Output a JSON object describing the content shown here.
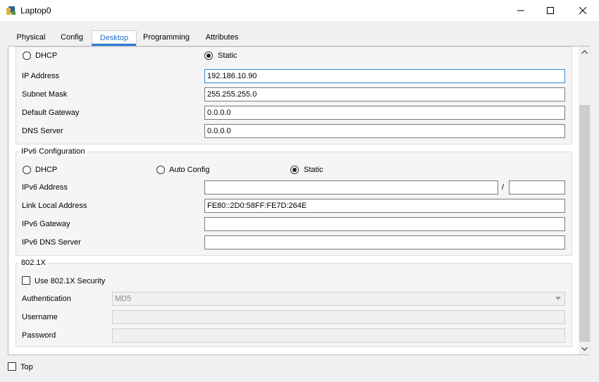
{
  "window": {
    "title": "Laptop0"
  },
  "tabs": [
    "Physical",
    "Config",
    "Desktop",
    "Programming",
    "Attributes"
  ],
  "ipv4": {
    "dhcp_label": "DHCP",
    "static_label": "Static",
    "mode": "Static",
    "ip_label": "IP Address",
    "ip_value": "192.186.10.90",
    "mask_label": "Subnet Mask",
    "mask_value": "255.255.255.0",
    "gateway_label": "Default Gateway",
    "gateway_value": "0.0.0.0",
    "dns_label": "DNS Server",
    "dns_value": "0.0.0.0"
  },
  "ipv6": {
    "legend": "IPv6 Configuration",
    "dhcp_label": "DHCP",
    "auto_label": "Auto Config",
    "static_label": "Static",
    "mode": "Static",
    "address_label": "IPv6 Address",
    "address_value": "",
    "prefix_sep": "/",
    "prefix_value": "",
    "link_local_label": "Link Local Address",
    "link_local_value": "FE80::2D0:58FF:FE7D:264E",
    "gateway_label": "IPv6 Gateway",
    "gateway_value": "",
    "dns_label": "IPv6 DNS Server",
    "dns_value": ""
  },
  "dot1x": {
    "legend": "802.1X",
    "use_security_label": "Use 802.1X Security",
    "use_security_checked": false,
    "auth_label": "Authentication",
    "auth_value": "MD5",
    "username_label": "Username",
    "username_value": "",
    "password_label": "Password",
    "password_value": ""
  },
  "footer": {
    "top_label": "Top",
    "top_checked": false
  },
  "colors": {
    "accent": "#2a7ad6",
    "tab_active_text": "#1e6fd0"
  },
  "icons": [
    "app-icon",
    "minimize-icon",
    "maximize-icon",
    "close-icon",
    "scroll-up-icon",
    "scroll-down-icon",
    "dropdown-arrow-icon"
  ]
}
